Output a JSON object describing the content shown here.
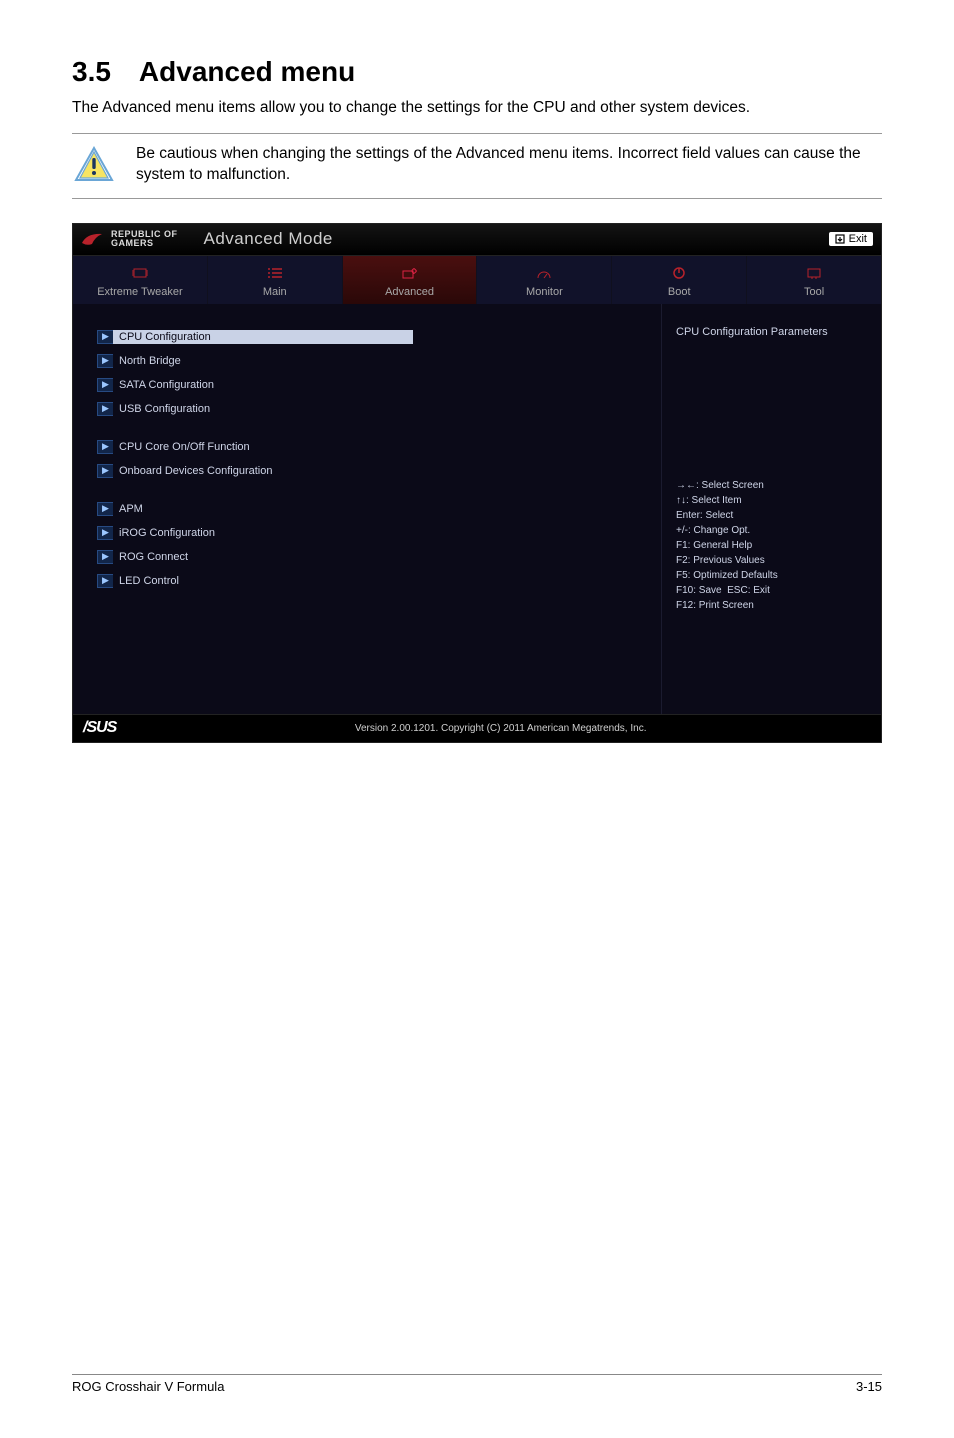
{
  "heading": "3.5 Advanced menu",
  "intro": "The Advanced menu items allow you to change the settings for the CPU and other system devices.",
  "callout": "Be cautious when changing the settings of the Advanced menu items. Incorrect field values can cause the system to malfunction.",
  "bios": {
    "brand_l1": "REPUBLIC OF",
    "brand_l2": "GAMERS",
    "mode": "Advanced Mode",
    "exit": "Exit",
    "tabs": {
      "extreme": "Extreme Tweaker",
      "main": "Main",
      "advanced": "Advanced",
      "monitor": "Monitor",
      "boot": "Boot",
      "tool": "Tool"
    },
    "menu": {
      "cpu": "CPU Configuration",
      "north": "North Bridge",
      "sata": "SATA Configuration",
      "usb": "USB Configuration",
      "cpucore": "CPU Core On/Off Function",
      "onboard": "Onboard Devices Configuration",
      "apm": "APM",
      "irog": "iROG Configuration",
      "rogc": "ROG Connect",
      "led": "LED Control"
    },
    "side": {
      "title": "CPU Configuration Parameters",
      "help": "→←: Select Screen\n↑↓: Select Item\nEnter: Select\n+/-: Change Opt.\nF1: General Help\nF2: Previous Values\nF5: Optimized Defaults\nF10: Save  ESC: Exit\nF12: Print Screen"
    },
    "footer_brand": "/SUS",
    "version": "Version 2.00.1201. Copyright (C) 2011 American Megatrends, Inc."
  },
  "page_footer_left": "ROG Crosshair V Formula",
  "page_footer_right": "3-15"
}
